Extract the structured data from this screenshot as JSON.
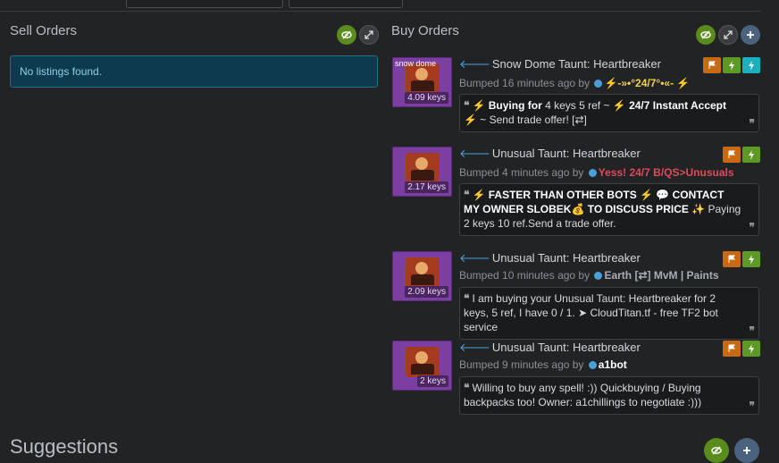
{
  "sell": {
    "title": "Sell Orders",
    "notice": "No listings found."
  },
  "buy": {
    "title": "Buy Orders",
    "listings": [
      {
        "effect": "snow dome",
        "price": "4.09 keys",
        "title": "Snow Dome Taunt: Heartbreaker",
        "bumped": "Bumped 16 minutes ago by",
        "user": "⚡-»•°24/7°•«- ⚡",
        "message_bold": "⚡ Buying for",
        "message": " 4 keys 5 ref ~ ⚡ ",
        "message_bold2": "24/7 Instant Accept",
        "message_end": " ⚡ ~ Send trade offer! [⇄]"
      },
      {
        "effect": "",
        "price": "2.17 keys",
        "title": "Unusual Taunt: Heartbreaker",
        "bumped": "Bumped 4 minutes ago by",
        "user": "Yess! 24/7 B/QS>Unusuals",
        "message_bold": "⚡ FASTER THAN OTHER BOTS ⚡ 💬 CONTACT MY OWNER SLOBEK💰 TO DISCUSS PRICE",
        "message": " ✨ Paying 2 keys 10 ref.Send a trade offer.",
        "message_bold2": "",
        "message_end": ""
      },
      {
        "effect": "",
        "price": "2.09 keys",
        "title": "Unusual Taunt: Heartbreaker",
        "bumped": "Bumped 10 minutes ago by",
        "user": "Earth [⇄] MvM | Paints",
        "message_bold": "",
        "message": "I am buying your Unusual Taunt: Heartbreaker for 2 keys, 5 ref, I have 0 / 1. ➤ CloudTitan.tf - free TF2 bot service",
        "message_bold2": "",
        "message_end": ""
      },
      {
        "effect": "",
        "price": "2 keys",
        "title": "Unusual Taunt: Heartbreaker",
        "bumped": "Bumped 9 minutes ago by",
        "user": "a1bot",
        "message_bold": "",
        "message": "Willing to buy any spell! :)) Quickbuying / Buying backpacks too!        Owner: a1chillings          to negotiate :)))",
        "message_bold2": "",
        "message_end": ""
      }
    ]
  },
  "suggestions": {
    "title": "Suggestions"
  },
  "icons": {
    "hide": "eye-slash-icon",
    "expand": "expand-icon",
    "add": "plus-icon",
    "flag": "flag-icon",
    "bolt": "lightning-icon"
  },
  "colors": {
    "accent_green": "#5a8b1d",
    "notice_bg": "#0e3a4d",
    "unusual_purple": "#7a3fa0"
  }
}
